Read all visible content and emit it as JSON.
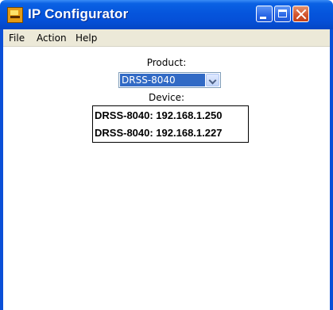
{
  "window": {
    "title": "IP Configurator",
    "icon": "app-icon"
  },
  "menubar": {
    "items": [
      {
        "label": "File"
      },
      {
        "label": "Action"
      },
      {
        "label": "Help"
      }
    ]
  },
  "product": {
    "label": "Product:",
    "selected": "DRSS-8040"
  },
  "device": {
    "label": "Device:",
    "items": [
      {
        "text": "DRSS-8040: 192.168.1.250"
      },
      {
        "text": "DRSS-8040: 192.168.1.227"
      }
    ]
  },
  "colors": {
    "titlebar": "#0555dc",
    "selection": "#316ac5",
    "close_button": "#d4562f"
  }
}
